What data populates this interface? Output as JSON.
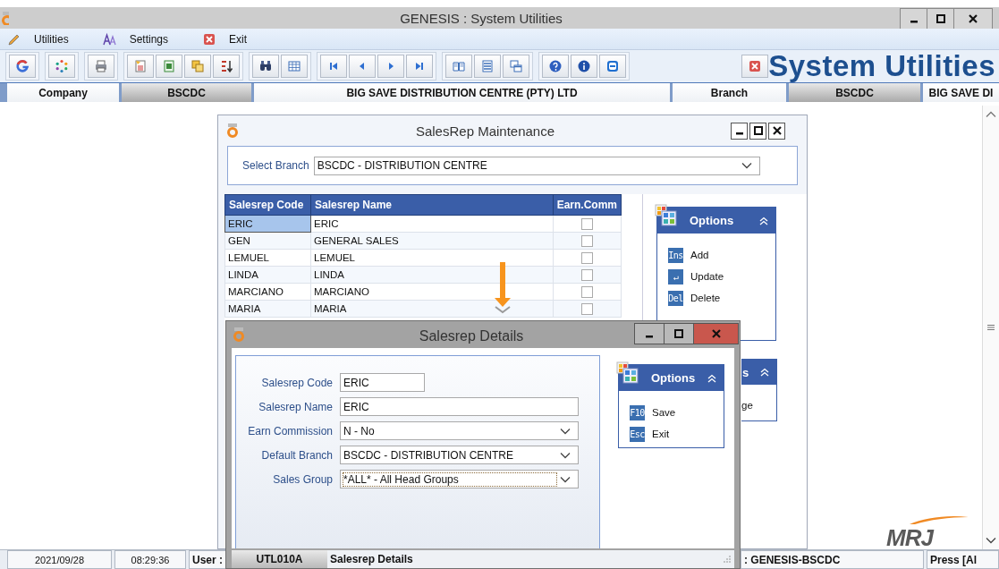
{
  "window": {
    "title": "GENESIS : System Utilities"
  },
  "menu": [
    {
      "label": "Utilities",
      "kind": "pencil"
    },
    {
      "label": "Settings",
      "kind": "font"
    },
    {
      "label": "Exit",
      "kind": "close"
    }
  ],
  "toolbar": {
    "groups": [
      [
        {
          "kind": "g-logo"
        }
      ],
      [
        {
          "kind": "refresh"
        }
      ],
      [
        {
          "kind": "print"
        }
      ],
      [
        {
          "kind": "new"
        },
        {
          "kind": "excel"
        },
        {
          "kind": "copy"
        },
        {
          "kind": "sort"
        }
      ],
      [
        {
          "kind": "find"
        },
        {
          "kind": "table"
        }
      ],
      [
        {
          "kind": "first"
        },
        {
          "kind": "prev"
        },
        {
          "kind": "next"
        },
        {
          "kind": "last"
        }
      ],
      [
        {
          "kind": "book"
        },
        {
          "kind": "rows"
        },
        {
          "kind": "windows"
        }
      ],
      [
        {
          "kind": "help"
        },
        {
          "kind": "info"
        },
        {
          "kind": "minus"
        }
      ]
    ],
    "banner": "System Utilities"
  },
  "info_bar": [
    {
      "text": "Company",
      "kind": "label"
    },
    {
      "text": "BSCDC",
      "kind": "value"
    },
    {
      "text": "BIG SAVE DISTRIBUTION CENTRE (PTY) LTD",
      "kind": "label"
    },
    {
      "text": "Branch",
      "kind": "label"
    },
    {
      "text": "BSCDC",
      "kind": "value"
    },
    {
      "text": "BIG SAVE DI",
      "kind": "label"
    }
  ],
  "maintenance": {
    "title": "SalesRep Maintenance",
    "branch_label": "Select Branch",
    "branch": "BSCDC - DISTRIBUTION CENTRE",
    "columns": [
      "Salesrep Code",
      "Salesrep Name",
      "Earn.Comm"
    ],
    "rows": [
      {
        "code": "ERIC",
        "name": "ERIC",
        "earn_comm": false,
        "selected": true
      },
      {
        "code": "GEN",
        "name": "GENERAL SALES",
        "earn_comm": false,
        "selected": false
      },
      {
        "code": "LEMUEL",
        "name": "LEMUEL",
        "earn_comm": false,
        "selected": false
      },
      {
        "code": "LINDA",
        "name": "LINDA",
        "earn_comm": false,
        "selected": false
      },
      {
        "code": "MARCIANO",
        "name": "MARCIANO",
        "earn_comm": false,
        "selected": false
      },
      {
        "code": "MARIA",
        "name": "MARIA",
        "earn_comm": false,
        "selected": false
      }
    ],
    "options": {
      "title": "Options",
      "items": [
        {
          "key": "Ins",
          "label": "Add"
        },
        {
          "key": "↵",
          "label": "Update"
        },
        {
          "key": "Del",
          "label": "Delete"
        }
      ]
    },
    "options_2": {
      "title": "s",
      "items": [
        {
          "label": "ge"
        }
      ]
    }
  },
  "details": {
    "title": "Salesrep Details",
    "fields": [
      {
        "label": "Salesrep Code",
        "value": "ERIC",
        "kind": "short",
        "focused": false
      },
      {
        "label": "Salesrep Name",
        "value": "ERIC",
        "kind": "text",
        "focused": false
      },
      {
        "label": "Earn Commission",
        "value": "N - No",
        "kind": "select",
        "focused": false
      },
      {
        "label": "Default Branch",
        "value": "BSCDC - DISTRIBUTION CENTRE",
        "kind": "select",
        "focused": false
      },
      {
        "label": "Sales Group",
        "value": "*ALL* - All Head Groups",
        "kind": "select",
        "focused": true
      }
    ],
    "options": {
      "title": "Options",
      "items": [
        {
          "key": "F10",
          "label": "Save"
        },
        {
          "key": "Esc",
          "label": "Exit"
        }
      ]
    },
    "status": [
      "UTL010A",
      "Salesrep Details"
    ]
  },
  "logo": {
    "text": "MRJ"
  },
  "status_bar": {
    "date": "2021/09/28",
    "time": "08:29:36",
    "user_label": "User :",
    "terminal": ": GENESIS-BSCDC",
    "hint": "Press [Al"
  }
}
